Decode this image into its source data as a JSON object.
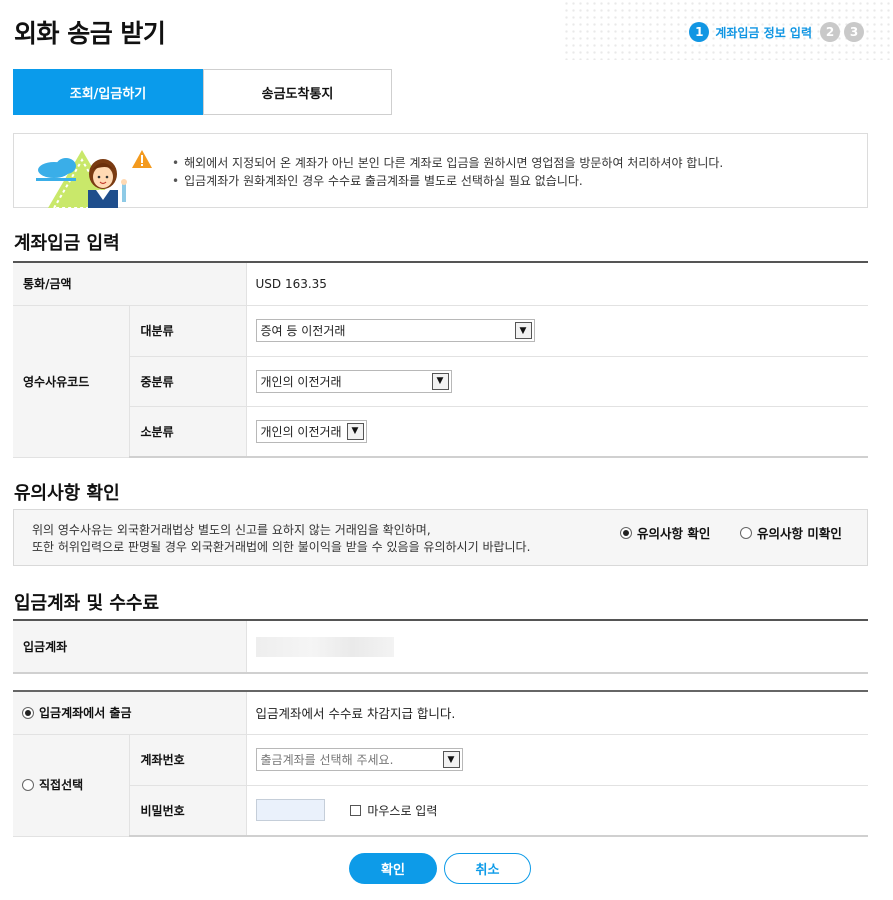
{
  "page": {
    "title": "외화 송금 받기"
  },
  "steps": {
    "items": [
      "1",
      "2",
      "3"
    ],
    "current_label": "계좌입금 정보 입력"
  },
  "tabs": [
    {
      "label": "조회/입금하기",
      "active": true
    },
    {
      "label": "송금도착통지",
      "active": false
    }
  ],
  "notice": {
    "lines": [
      "해외에서 지정되어 온 계좌가 아닌 본인 다른 계좌로 입금을 원하시면 영업점을 방문하여 처리하셔야 합니다.",
      "입금계좌가 원화계좌인 경우 수수료 출금계좌를 별도로 선택하실 필요 없습니다."
    ]
  },
  "deposit_section": {
    "title": "계좌입금 입력",
    "currency_label": "통화/금액",
    "currency_value": "USD 163.35",
    "reason_label": "영수사유코드",
    "major_label": "대분류",
    "major_value": "증여 등 이전거래",
    "middle_label": "중분류",
    "middle_value": "개인의 이전거래",
    "minor_label": "소분류",
    "minor_value": "개인의 이전거래"
  },
  "caution_section": {
    "title": "유의사항 확인",
    "text_line1": "위의 영수사유는 외국환거래법상 별도의 신고를 요하지 않는 거래임을 확인하며,",
    "text_line2": "또한 허위입력으로 판명될 경우 외국환거래법에 의한 불이익을 받을 수 있음을 유의하시기 바랍니다.",
    "option_confirm": "유의사항 확인",
    "option_unconfirm": "유의사항 미확인"
  },
  "account_section": {
    "title": "입금계좌 및 수수료",
    "deposit_account_label": "입금계좌",
    "withdraw_option_label": "입금계좌에서 출금",
    "withdraw_option_desc": "입금계좌에서 수수료 차감지급 합니다.",
    "direct_option_label": "직접선택",
    "account_no_label": "계좌번호",
    "account_select_placeholder": "출금계좌를 선택해 주세요.",
    "password_label": "비밀번호",
    "mouse_input_label": "마우스로 입력"
  },
  "buttons": {
    "confirm": "확인",
    "cancel": "취소"
  },
  "colors": {
    "accent": "#0a9beb",
    "step_inactive": "#c9c9c9"
  }
}
